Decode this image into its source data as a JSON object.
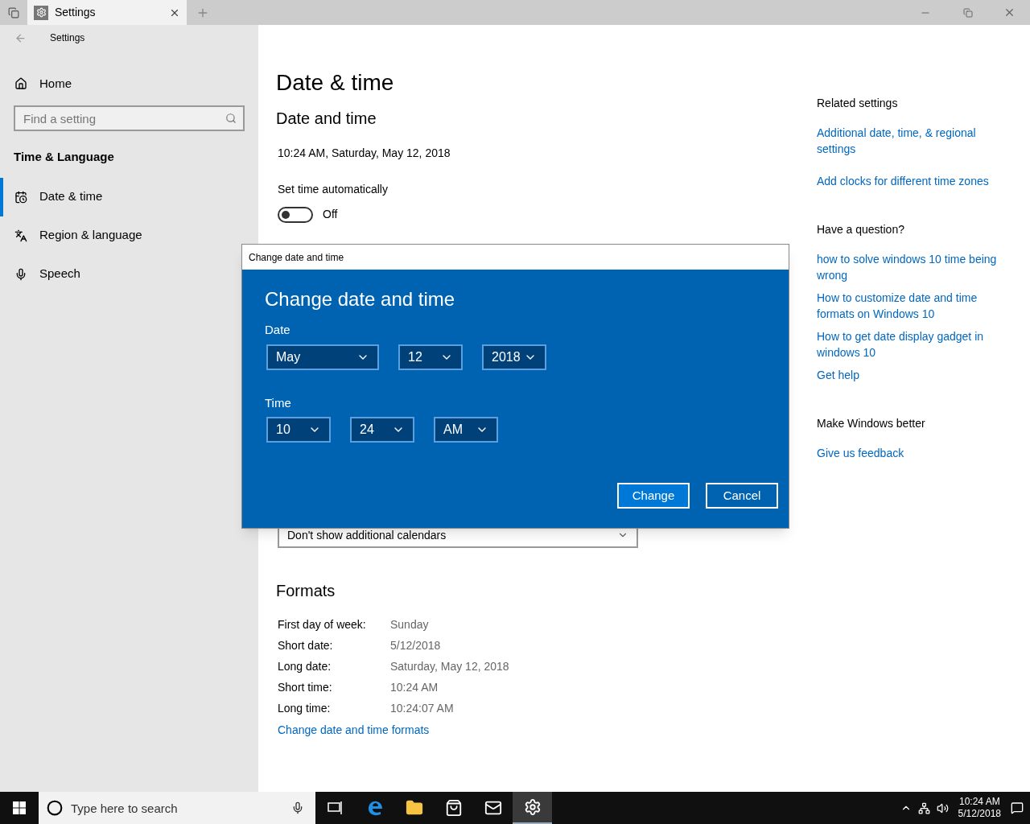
{
  "window": {
    "tab_title": "Settings",
    "app_title": "Settings"
  },
  "sidebar": {
    "home": "Home",
    "search": {
      "placeholder": "Find a setting"
    },
    "section": "Time & Language",
    "items": [
      {
        "label": "Date & time",
        "selected": true
      },
      {
        "label": "Region & language",
        "selected": false
      },
      {
        "label": "Speech",
        "selected": false
      }
    ]
  },
  "main": {
    "heading": "Date & time",
    "subheading": "Date and time",
    "current": "10:24 AM, Saturday, May 12, 2018",
    "auto_time": {
      "label": "Set time automatically",
      "on": false,
      "state_text": "Off"
    },
    "calendar_dropdown": {
      "value": "Don't show additional calendars"
    },
    "formats": {
      "heading": "Formats",
      "rows": [
        {
          "label": "First day of week:",
          "value": "Sunday"
        },
        {
          "label": "Short date:",
          "value": "5/12/2018"
        },
        {
          "label": "Long date:",
          "value": "Saturday, May 12, 2018"
        },
        {
          "label": "Short time:",
          "value": "10:24 AM"
        },
        {
          "label": "Long time:",
          "value": "10:24:07 AM"
        }
      ],
      "link": "Change date and time formats"
    }
  },
  "related": [
    {
      "heading": "Related settings",
      "links": [
        "Additional date, time, & regional settings",
        "Add clocks for different time zones"
      ]
    },
    {
      "heading": "Have a question?",
      "links": [
        "how to solve windows 10 time being wrong",
        "How to customize date and time formats on Windows 10",
        "How to get date display gadget in windows 10",
        "Get help"
      ]
    },
    {
      "heading": "Make Windows better",
      "links": [
        "Give us feedback"
      ]
    }
  ],
  "dialog": {
    "title": "Change date and time",
    "heading": "Change date and time",
    "groups": [
      {
        "label": "Date",
        "fields": [
          "May",
          "12",
          "2018"
        ]
      },
      {
        "label": "Time",
        "fields": [
          "10",
          "24",
          "AM"
        ]
      }
    ],
    "buttons": [
      "Change",
      "Cancel"
    ]
  },
  "taskbar": {
    "search": {
      "placeholder": "Type here to search"
    },
    "apps": [
      {
        "selected": false
      },
      {
        "selected": false
      },
      {
        "selected": false
      },
      {
        "selected": false
      },
      {
        "selected": false
      },
      {
        "selected": true
      }
    ],
    "clock": {
      "time": "10:24 AM",
      "date": "5/12/2018"
    }
  }
}
